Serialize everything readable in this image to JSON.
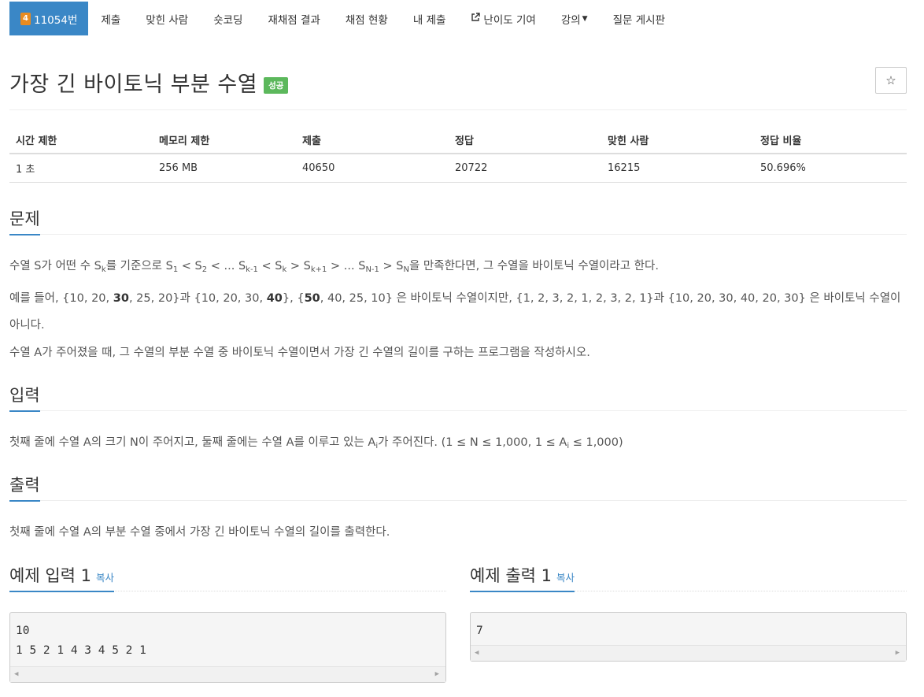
{
  "tabs": [
    {
      "badge": "4",
      "label": "11054번",
      "active": true
    },
    {
      "label": "제출"
    },
    {
      "label": "맞힌 사람"
    },
    {
      "label": "숏코딩"
    },
    {
      "label": "재채점 결과"
    },
    {
      "label": "채점 현황"
    },
    {
      "label": "내 제출"
    },
    {
      "label": "난이도 기여",
      "icon": "external-link-icon"
    },
    {
      "label": "강의",
      "icon": "caret-down-icon"
    },
    {
      "label": "질문 게시판"
    }
  ],
  "title": "가장 긴 바이토닉 부분 수열",
  "status_badge": "성공",
  "star_button": "☆",
  "info": {
    "headers": [
      "시간 제한",
      "메모리 제한",
      "제출",
      "정답",
      "맞힌 사람",
      "정답 비율"
    ],
    "values": [
      "1 초",
      "256 MB",
      "40650",
      "20722",
      "16215",
      "50.696%"
    ]
  },
  "sections": {
    "problem": {
      "heading": "문제",
      "p1": {
        "t1": "수열 S가 어떤 수 S",
        "s1": "k",
        "t2": "를 기준으로 S",
        "s2": "1",
        "t3": " < S",
        "s3": "2",
        "t4": " < ... S",
        "s4": "k-1",
        "t5": " < S",
        "s5": "k",
        "t6": " > S",
        "s6": "k+1",
        "t7": " > ... S",
        "s7": "N-1",
        "t8": " > S",
        "s8": "N",
        "t9": "을 만족한다면, 그 수열을 바이토닉 수열이라고 한다."
      },
      "p2": {
        "a": "예를 들어, {10, 20, ",
        "b1": "30",
        "c": ", 25, 20}과 {10, 20, 30, ",
        "b2": "40",
        "d": "}, {",
        "b3": "50",
        "e": ", 40, 25, 10} 은 바이토닉 수열이지만,  {1, 2, 3, 2, 1, 2, 3, 2, 1}과 {10, 20, 30, 40, 20, 30} 은 바이토닉 수열이 아니다."
      },
      "p3": "수열 A가 주어졌을 때, 그 수열의 부분 수열 중 바이토닉 수열이면서 가장 긴 수열의 길이를 구하는 프로그램을 작성하시오."
    },
    "input": {
      "heading": "입력",
      "p": {
        "t1": "첫째 줄에 수열 A의 크기 N이 주어지고, 둘째 줄에는 수열 A를 이루고 있는 A",
        "s1": "i",
        "t2": "가 주어진다. (1 ≤ N ≤ 1,000, 1 ≤ A",
        "s2": "i",
        "t3": " ≤ 1,000)"
      }
    },
    "output": {
      "heading": "출력",
      "p": "첫째 줄에 수열 A의 부분 수열 중에서 가장 긴 바이토닉 수열의 길이를 출력한다."
    }
  },
  "samples": {
    "input": {
      "heading": "예제 입력 1",
      "copy": "복사",
      "content": "10\n1 5 2 1 4 3 4 5 2 1"
    },
    "output": {
      "heading": "예제 출력 1",
      "copy": "복사",
      "content": "7"
    }
  },
  "colors": {
    "accent": "#3a87c6",
    "success": "#5cb85c",
    "badge": "#e88b20"
  }
}
